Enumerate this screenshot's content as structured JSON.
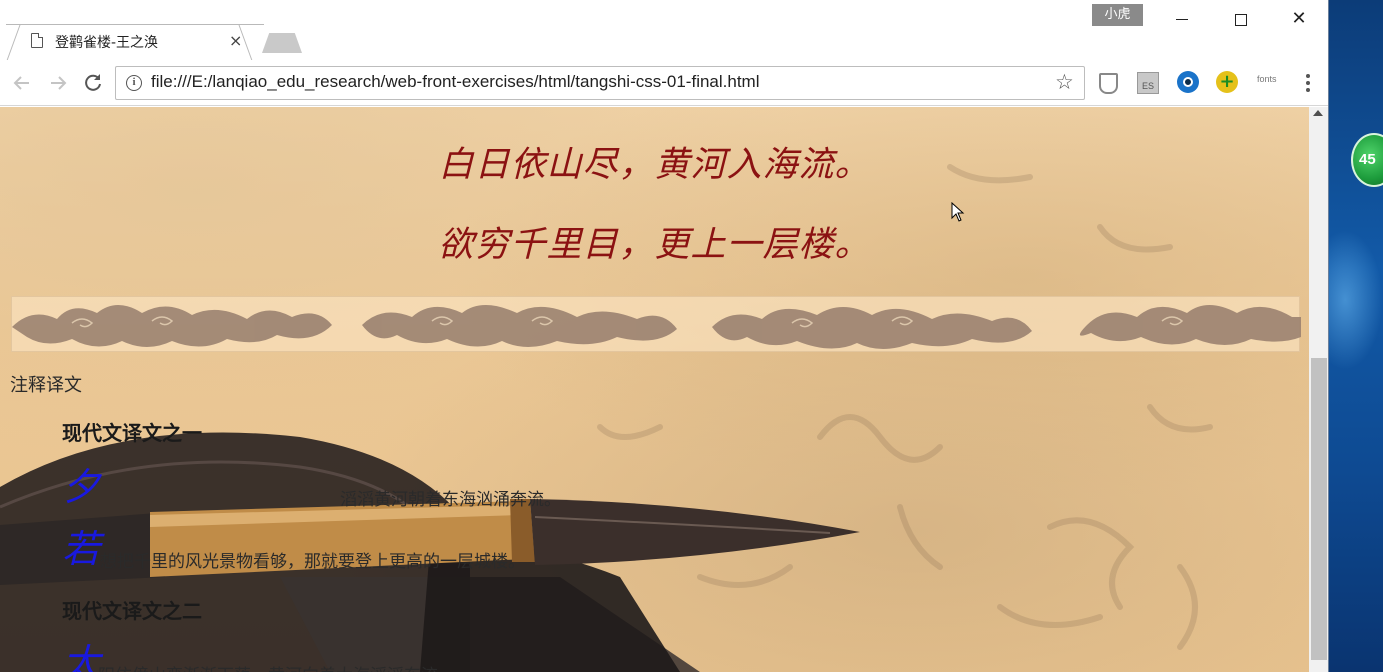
{
  "browser": {
    "tab_title": "登鹳雀楼-王之涣",
    "tab_close": "×",
    "user_badge": "小虎",
    "url": "file:///E:/lanqiao_edu_research/web-front-exercises/html/tangshi-css-01-final.html",
    "extension_fonts_label": "fonts",
    "extension_es_label": "ES",
    "win_close": "✕"
  },
  "icons": {
    "back": "arrow-left-icon",
    "forward": "arrow-right-icon",
    "reload": "reload-icon",
    "info": "info-icon",
    "bookmark": "star-icon",
    "menu": "kebab-menu-icon"
  },
  "desktop": {
    "widget_value": "45"
  },
  "page": {
    "poem_lines": [
      "白日依山尽，黄河入海流。",
      "欲穷千里目，更上一层楼。"
    ],
    "section_title": "注释译文",
    "translation1_title": "现代文译文之一",
    "translation1_paras": [
      {
        "dropcap": "夕",
        "text": "滔滔黄河朝着东海汹涌奔流。"
      },
      {
        "dropcap": "若",
        "text": "想把千里的风光景物看够，那就要登上更高的一层城楼。"
      }
    ],
    "translation2_title": "现代文译文之二",
    "translation2_paras": [
      {
        "dropcap": "太",
        "text": "阳依傍山峦渐渐下落，黄河向着大海滔滔东流。"
      }
    ]
  },
  "colors": {
    "poem": "#8b1212",
    "dropcap": "#1919e0",
    "background": "#ecc895"
  }
}
